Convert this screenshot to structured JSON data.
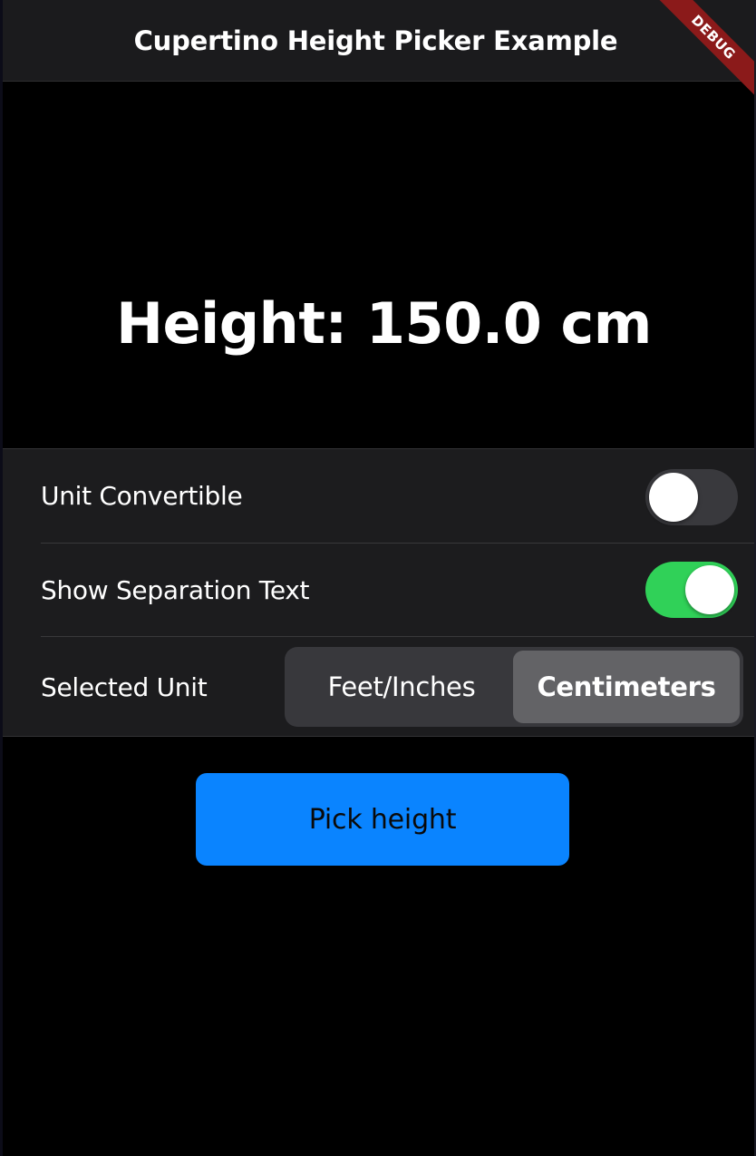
{
  "navbar": {
    "title": "Cupertino Height Picker Example"
  },
  "debug_banner": {
    "label": "DEBUG"
  },
  "main": {
    "height_text": "Height: 150.0 cm"
  },
  "settings": {
    "unit_convertible": {
      "label": "Unit Convertible",
      "enabled": false
    },
    "show_separation_text": {
      "label": "Show Separation Text",
      "enabled": true
    },
    "selected_unit": {
      "label": "Selected Unit",
      "options": [
        "Feet/Inches",
        "Centimeters"
      ],
      "selected": "Centimeters"
    }
  },
  "actions": {
    "pick_height_label": "Pick height"
  },
  "colors": {
    "accent": "#0a84ff",
    "switch_on": "#30d158",
    "switch_off": "#39393d",
    "debug_ribbon": "#8b1a1a"
  }
}
